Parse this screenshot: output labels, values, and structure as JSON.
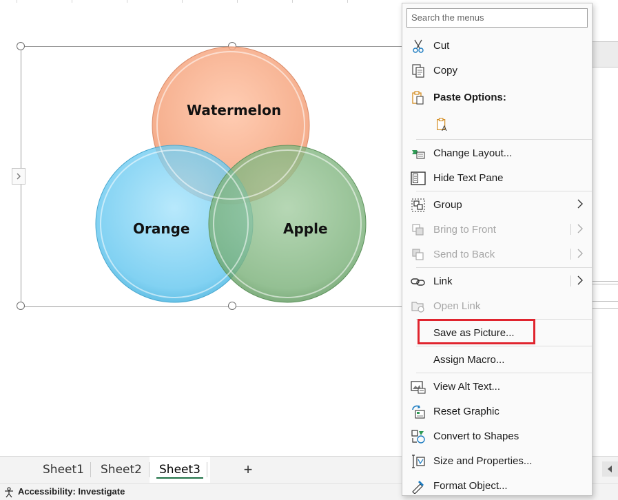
{
  "smartart": {
    "circles": [
      {
        "label": "Watermelon",
        "color": "#f4a882"
      },
      {
        "label": "Orange",
        "color": "#6ecdf2"
      },
      {
        "label": "Apple",
        "color": "#7fb57e"
      }
    ]
  },
  "sheet_tabs": {
    "tabs": [
      "Sheet1",
      "Sheet2",
      "Sheet3"
    ],
    "active": "Sheet3",
    "add_label": "+"
  },
  "status_bar": {
    "accessibility": "Accessibility: Investigate"
  },
  "context_menu": {
    "search_placeholder": "Search the menus",
    "items": {
      "cut": "Cut",
      "copy": "Copy",
      "paste_options": "Paste Options:",
      "change_layout": "Change Layout...",
      "hide_text_pane": "Hide Text Pane",
      "group": "Group",
      "bring_to_front": "Bring to Front",
      "send_to_back": "Send to Back",
      "link": "Link",
      "open_link": "Open Link",
      "save_as_picture": "Save as Picture...",
      "assign_macro": "Assign Macro...",
      "view_alt_text": "View Alt Text...",
      "reset_graphic": "Reset Graphic",
      "convert_to_shapes": "Convert to Shapes",
      "size_and_properties": "Size and Properties...",
      "format_object": "Format Object..."
    },
    "highlight_color": "#e0242e"
  }
}
